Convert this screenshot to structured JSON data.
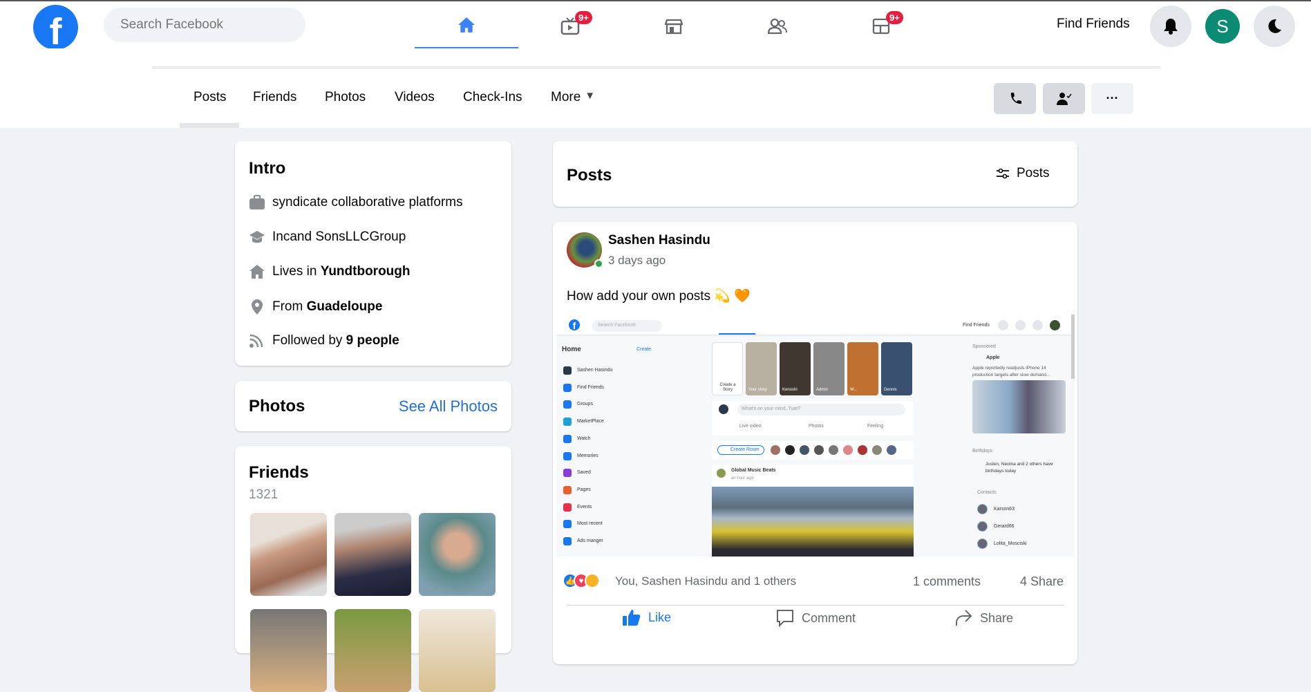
{
  "topbar": {
    "logo": "f",
    "search_placeholder": "Search Facebook",
    "nav": [
      {
        "icon": "home-icon",
        "active": true
      },
      {
        "icon": "tv-icon",
        "badge": "9+"
      },
      {
        "icon": "marketplace-icon"
      },
      {
        "icon": "groups-icon"
      },
      {
        "icon": "gaming-icon",
        "badge": "9+"
      }
    ],
    "find_friends": "Find Friends",
    "avatar_letter": "S",
    "accent": "#3b82f6"
  },
  "profile_tabs": [
    "Posts",
    "Friends",
    "Photos",
    "Videos",
    "Check-Ins",
    "More"
  ],
  "intro": {
    "title": "Intro",
    "work": "syndicate collaborative platforms",
    "education": "Incand SonsLLCGroup",
    "lives_prefix": "Lives in ",
    "lives": "Yundtborough",
    "from_prefix": "From ",
    "from": "Guadeloupe",
    "followed_prefix": "Followed by ",
    "followed": "9 people"
  },
  "photos": {
    "title": "Photos",
    "see_all": "See All Photos"
  },
  "friends": {
    "title": "Friends",
    "count": "1321"
  },
  "posts_header": {
    "title": "Posts",
    "filter": "Posts"
  },
  "post": {
    "author": "Sashen Hasindu",
    "time": "3 days ago",
    "text": "How add your own posts 💫 🧡",
    "reactions_text": "You, Sashen Hasindu and 1 others",
    "comments": "1 comments",
    "shares": "4 Share",
    "actions": {
      "like": "Like",
      "comment": "Comment",
      "share": "Share"
    }
  },
  "embedded": {
    "search": "Search Facebook",
    "find_friends": "Find Friends",
    "home": "Home",
    "create": "Create",
    "sidebar": [
      "Sashen Hasindu",
      "Find Friends",
      "Groups",
      "MarketPlace",
      "Watch",
      "Memories",
      "Saved",
      "Pages",
      "Events",
      "Most recent",
      "Ads manger"
    ],
    "stories": [
      "Create a Story",
      "Your story",
      "Kenoshi",
      "Admin",
      "W...",
      "Dennis"
    ],
    "composer": "What's on your mind, Tuat?",
    "composer_actions": [
      "Live video",
      "Photos",
      "Feeling"
    ],
    "create_room": "Create Room",
    "post_author": "Global Music Beats",
    "post_time": "an hour ago",
    "sponsored": "Sponsored",
    "sponsor": "Apple",
    "ad_text": "Apple reportedly readjusts iPhone 14 production targets after slow demand...",
    "birthdays": "Birthdays",
    "birthday_text": "Justen, Neoma and 2 others have birthdays today",
    "contacts": "Contacts",
    "contact_list": [
      "Karson63",
      "Gerard66",
      "Lolita_Mosciski"
    ]
  }
}
